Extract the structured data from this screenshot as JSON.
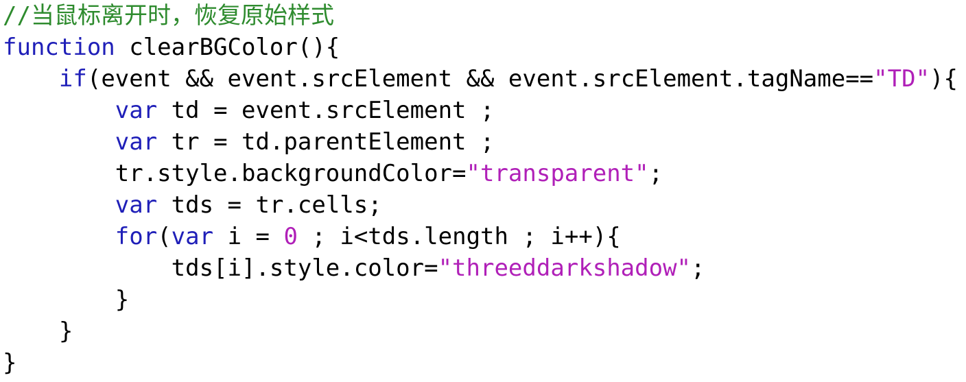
{
  "colors": {
    "keyword": "#1f1fb8",
    "string": "#b020b8",
    "comment": "#2e8b2e",
    "plain": "#000000",
    "background": "#ffffff"
  },
  "code": {
    "lines": [
      {
        "tokens": [
          {
            "t": "cm",
            "v": "//当鼠标离开时，恢复原始样式"
          }
        ]
      },
      {
        "tokens": [
          {
            "t": "kw",
            "v": "function"
          },
          {
            "t": "pl",
            "v": " clearBGColor(){"
          }
        ]
      },
      {
        "tokens": [
          {
            "t": "pl",
            "v": "    "
          },
          {
            "t": "kw",
            "v": "if"
          },
          {
            "t": "pl",
            "v": "(event && event.srcElement && event.srcElement.tagName=="
          },
          {
            "t": "str",
            "v": "\"TD\""
          },
          {
            "t": "pl",
            "v": "){"
          }
        ]
      },
      {
        "tokens": [
          {
            "t": "pl",
            "v": "        "
          },
          {
            "t": "kw",
            "v": "var"
          },
          {
            "t": "pl",
            "v": " td = event.srcElement ;"
          }
        ]
      },
      {
        "tokens": [
          {
            "t": "pl",
            "v": "        "
          },
          {
            "t": "kw",
            "v": "var"
          },
          {
            "t": "pl",
            "v": " tr = td.parentElement ;"
          }
        ]
      },
      {
        "tokens": [
          {
            "t": "pl",
            "v": "        tr.style.backgroundColor="
          },
          {
            "t": "str",
            "v": "\"transparent\""
          },
          {
            "t": "pl",
            "v": ";"
          }
        ]
      },
      {
        "tokens": [
          {
            "t": "pl",
            "v": "        "
          },
          {
            "t": "kw",
            "v": "var"
          },
          {
            "t": "pl",
            "v": " tds = tr.cells;"
          }
        ]
      },
      {
        "tokens": [
          {
            "t": "pl",
            "v": "        "
          },
          {
            "t": "kw",
            "v": "for"
          },
          {
            "t": "pl",
            "v": "("
          },
          {
            "t": "kw",
            "v": "var"
          },
          {
            "t": "pl",
            "v": " i = "
          },
          {
            "t": "num",
            "v": "0"
          },
          {
            "t": "pl",
            "v": " ; i<tds.length ; i++){"
          }
        ]
      },
      {
        "tokens": [
          {
            "t": "pl",
            "v": "            tds[i].style.color="
          },
          {
            "t": "str",
            "v": "\"threeddarkshadow\""
          },
          {
            "t": "pl",
            "v": ";"
          }
        ]
      },
      {
        "tokens": [
          {
            "t": "pl",
            "v": "        }"
          }
        ]
      },
      {
        "tokens": [
          {
            "t": "pl",
            "v": "    }"
          }
        ]
      },
      {
        "tokens": [
          {
            "t": "pl",
            "v": "}"
          }
        ]
      }
    ]
  }
}
